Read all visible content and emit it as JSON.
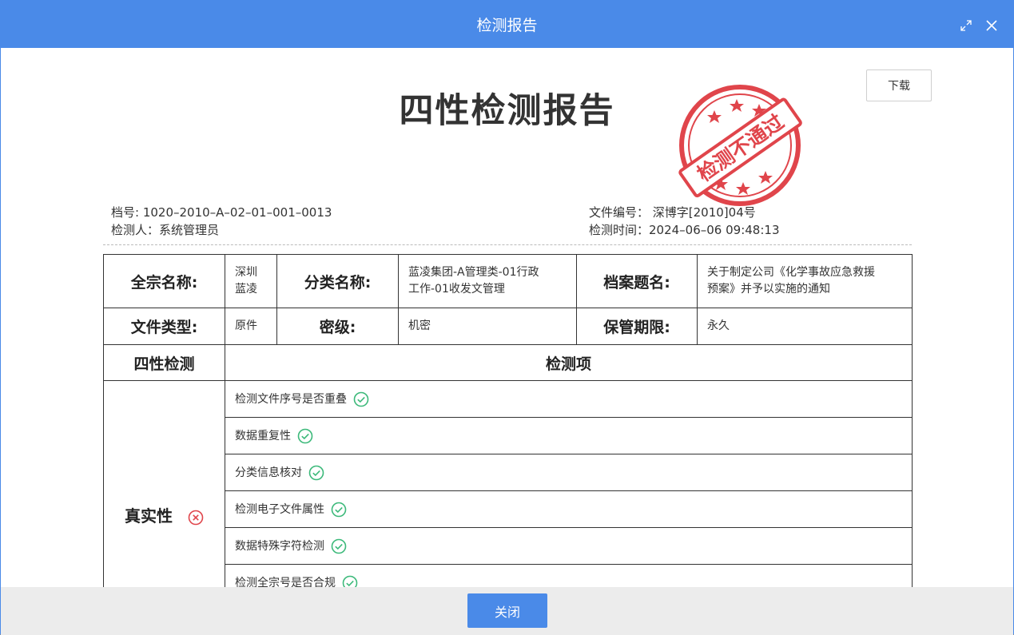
{
  "dialog": {
    "title": "检测报告"
  },
  "report": {
    "title": "四性检测报告",
    "download_label": "下载",
    "stamp_text": "检测不通过",
    "archive_no": "档号: 1020–2010–A–02–01–001–0013",
    "inspector": "检测人：系统管理员",
    "file_no": "文件编号： 深博字[2010]04号",
    "check_time": "检测时间：2024–06–06 09:48:13"
  },
  "table": {
    "row1": {
      "l1": "全宗名称:",
      "v1a": "深圳",
      "v1b": "蓝凌",
      "l2": "分类名称:",
      "v2a": "蓝凌集团-A管理类-01行政",
      "v2b": "工作-01收发文管理",
      "l3": "档案题名:",
      "v3a": "关于制定公司《化学事故应急救援",
      "v3b": "预案》并予以实施的通知"
    },
    "row2": {
      "l1": "文件类型:",
      "v1": "原件",
      "l2": "密级:",
      "v2": "机密",
      "l3": "保管期限:",
      "v3": "永久"
    },
    "head_left": "四性检测",
    "head_right": "检测项",
    "category": "真实性",
    "items": [
      "检测文件序号是否重叠",
      "数据重复性",
      "分类信息核对",
      "检测电子文件属性",
      "数据特殊字符检测",
      "检测全宗号是否合规"
    ]
  },
  "footer": {
    "close_label": "关闭"
  },
  "colors": {
    "primary": "#4a8ae8",
    "stamp": "#e0454b",
    "ok": "#3cb97a",
    "fail": "#e0454b"
  }
}
